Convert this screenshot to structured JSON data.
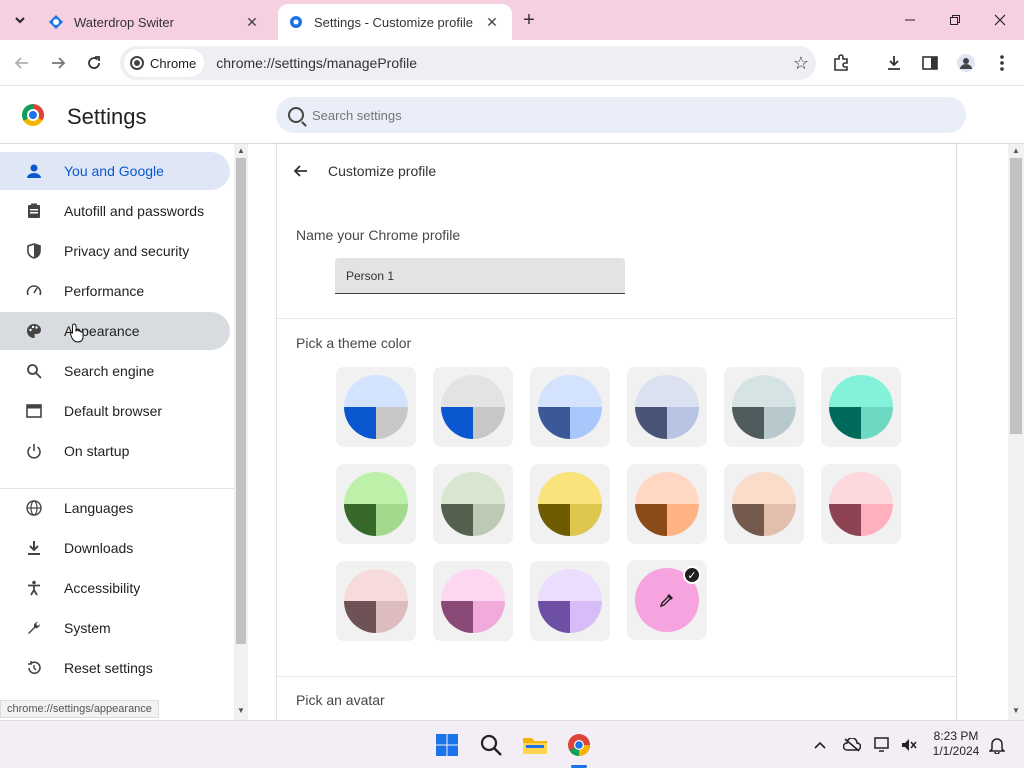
{
  "browser": {
    "tabs": [
      {
        "title": "Waterdrop Switer",
        "active": false
      },
      {
        "title": "Settings - Customize profile",
        "active": true
      }
    ],
    "omnibox": {
      "chip_label": "Chrome",
      "url": "chrome://settings/manageProfile"
    }
  },
  "settings": {
    "title": "Settings",
    "search_placeholder": "Search settings",
    "sidebar": {
      "items": [
        {
          "label": "You and Google",
          "icon": "person-icon",
          "state": "active"
        },
        {
          "label": "Autofill and passwords",
          "icon": "clipboard-icon"
        },
        {
          "label": "Privacy and security",
          "icon": "shield-icon"
        },
        {
          "label": "Performance",
          "icon": "speedometer-icon"
        },
        {
          "label": "Appearance",
          "icon": "palette-icon",
          "state": "hover"
        },
        {
          "label": "Search engine",
          "icon": "search-icon"
        },
        {
          "label": "Default browser",
          "icon": "browser-icon"
        },
        {
          "label": "On startup",
          "icon": "power-icon"
        },
        {
          "label": "Languages",
          "icon": "globe-icon"
        },
        {
          "label": "Downloads",
          "icon": "download-icon"
        },
        {
          "label": "Accessibility",
          "icon": "accessibility-icon"
        },
        {
          "label": "System",
          "icon": "wrench-icon"
        },
        {
          "label": "Reset settings",
          "icon": "reset-icon"
        }
      ]
    },
    "status_url": "chrome://settings/appearance",
    "page": {
      "title": "Customize profile",
      "name_section": "Name your Chrome profile",
      "profile_name": "Person 1",
      "theme_section": "Pick a theme color",
      "avatar_section": "Pick an avatar",
      "theme_colors": [
        {
          "top": "#d3e3fd",
          "bl": "#0b57d0",
          "br": "#c7c7c7"
        },
        {
          "top": "#e3e3e3",
          "bl": "#0b57d0",
          "br": "#c7c7c7"
        },
        {
          "top": "#d3e3fd",
          "bl": "#3b5998",
          "br": "#a8c7fa"
        },
        {
          "top": "#dbe1f1",
          "bl": "#4a5478",
          "br": "#b9c3e3"
        },
        {
          "top": "#d6e3e5",
          "bl": "#4f5b5d",
          "br": "#b7c9cc"
        },
        {
          "top": "#83f2da",
          "bl": "#006b5a",
          "br": "#6fd8c2"
        },
        {
          "top": "#bdf0a8",
          "bl": "#37692a",
          "br": "#a2d98d"
        },
        {
          "top": "#d8e6d0",
          "bl": "#55604f",
          "br": "#bccab4"
        },
        {
          "top": "#fae37a",
          "bl": "#6e5c00",
          "br": "#dec64f"
        },
        {
          "top": "#ffd7c2",
          "bl": "#8b4c18",
          "br": "#ffb384"
        },
        {
          "top": "#f9dcca",
          "bl": "#735a4d",
          "br": "#e2bfac"
        },
        {
          "top": "#fdd8dd",
          "bl": "#8d4352",
          "br": "#ffb0bc"
        },
        {
          "top": "#f7dbdc",
          "bl": "#6e5256",
          "br": "#dcbcbf"
        },
        {
          "top": "#fdd6f2",
          "bl": "#8a4a78",
          "br": "#f0abdb"
        },
        {
          "top": "#eaddfd",
          "bl": "#6e4fa6",
          "br": "#d7bdf8"
        }
      ],
      "custom_color": {
        "color": "#f7a3e0",
        "icon": "eyedropper-icon",
        "selected": true
      }
    }
  },
  "taskbar": {
    "apps": [
      "windows-start-icon",
      "search-icon",
      "file-explorer-icon",
      "chrome-icon"
    ],
    "time": "8:23 PM",
    "date": "1/1/2024"
  }
}
